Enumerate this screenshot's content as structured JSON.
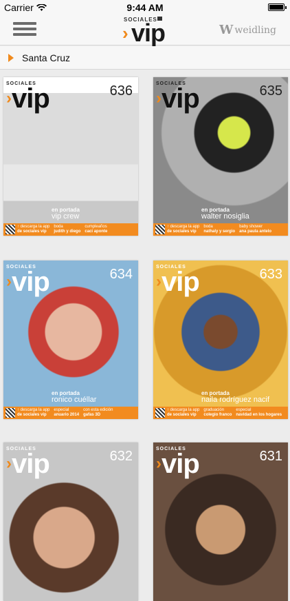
{
  "status": {
    "carrier": "Carrier",
    "time": "9:44 AM",
    "battery_level": 1.0
  },
  "nav": {
    "logo_small": "SOCIALES",
    "logo_main": "vip",
    "partner_brand": "weidling"
  },
  "breadcrumb": {
    "location": "Santa Cruz"
  },
  "covers": [
    {
      "masthead": "SOCIALES",
      "brand": "vip",
      "issue": "636",
      "feature_label": "en portada",
      "feature_name": "vip crew",
      "strip": [
        {
          "t": "↑ descarga la app",
          "b": "de sociales vip"
        },
        {
          "t": "boda",
          "b": "judith y diego"
        },
        {
          "t": "cumpleaños",
          "b": "caci aponte"
        }
      ]
    },
    {
      "masthead": "SOCIALES",
      "brand": "vip",
      "issue": "635",
      "feature_label": "en portada",
      "feature_name": "walter nosiglia",
      "strip": [
        {
          "t": "↑ descarga la app",
          "b": "de sociales vip"
        },
        {
          "t": "boda",
          "b": "nathaly y sergio"
        },
        {
          "t": "baby shower",
          "b": "ana paula antelo"
        }
      ]
    },
    {
      "masthead": "SOCIALES",
      "brand": "vip",
      "issue": "634",
      "feature_label": "en portada",
      "feature_name": "ronico cuéllar",
      "strip": [
        {
          "t": "↑ descarga la app",
          "b": "de sociales vip"
        },
        {
          "t": "especial",
          "b": "anuario 2014"
        },
        {
          "t": "con esta edición",
          "b": "gafas 3D"
        }
      ]
    },
    {
      "masthead": "SOCIALES",
      "brand": "vip",
      "issue": "633",
      "feature_label": "en portada",
      "feature_name": "naila rodríguez nacif",
      "strip": [
        {
          "t": "↑ descarga la app",
          "b": "de sociales vip"
        },
        {
          "t": "graduación",
          "b": "colegio franco"
        },
        {
          "t": "especial",
          "b": "navidad en los hogares"
        }
      ]
    },
    {
      "masthead": "SOCIALES",
      "brand": "vip",
      "issue": "632",
      "feature_label": "",
      "feature_name": "",
      "strip": []
    },
    {
      "masthead": "SOCIALES",
      "brand": "vip",
      "issue": "631",
      "feature_label": "",
      "feature_name": "",
      "strip": []
    }
  ],
  "colors": {
    "accent": "#f08a1c",
    "bar": "#f7f7f7"
  }
}
